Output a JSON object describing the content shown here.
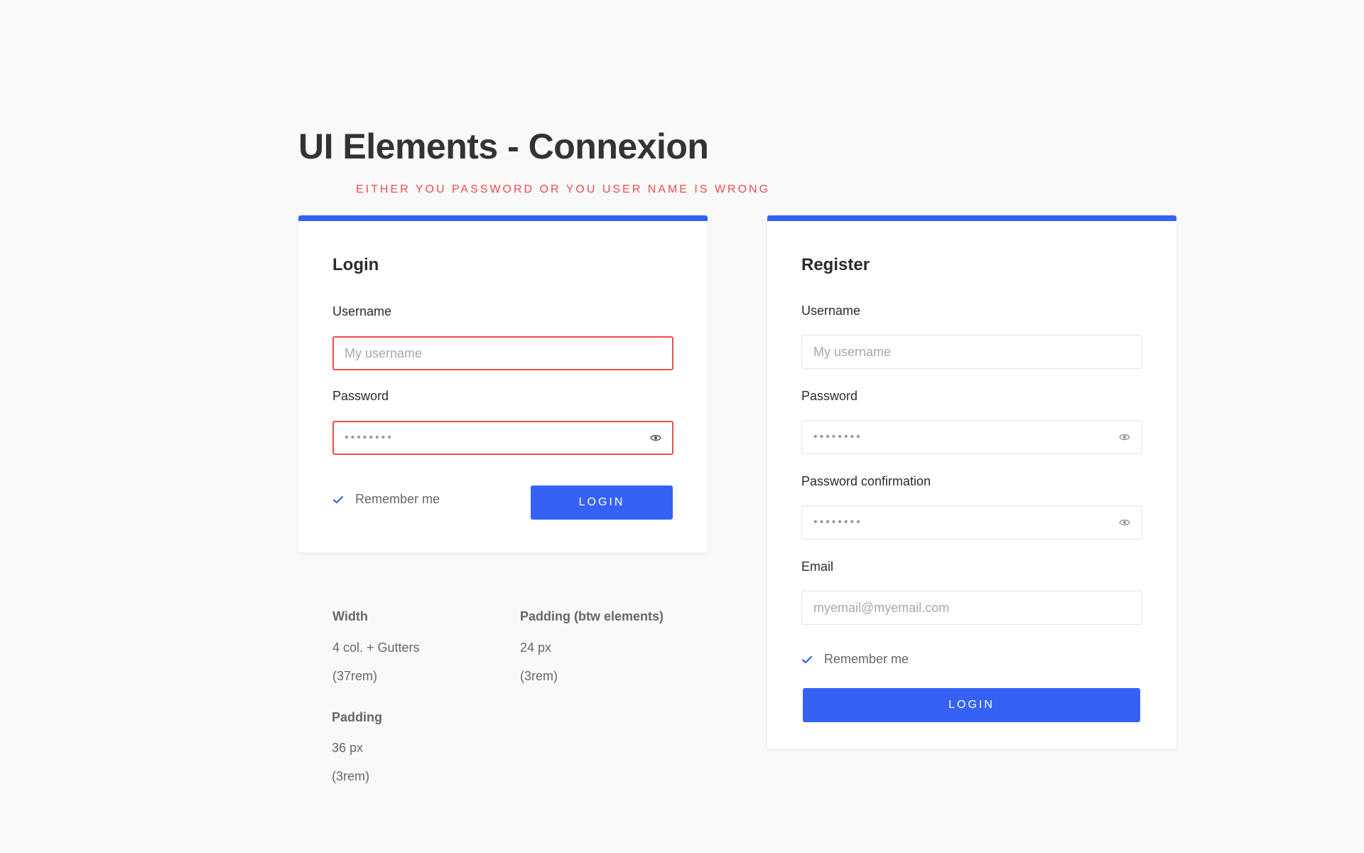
{
  "page": {
    "title": "UI Elements - Connexion",
    "error_message": "EITHER YOU PASSWORD OR YOU USER NAME IS WRONG"
  },
  "colors": {
    "accent": "#3562f5",
    "error": "#ef4c4c",
    "background": "#f9f9f9"
  },
  "login": {
    "title": "Login",
    "username_label": "Username",
    "username_placeholder": "My username",
    "username_value": "",
    "password_label": "Password",
    "password_mask": "••••••••",
    "password_toggle_icon": "eye-icon",
    "remember_label": "Remember me",
    "remember_checked": true,
    "button_label": "LOGIN"
  },
  "register": {
    "title": "Register",
    "username_label": "Username",
    "username_placeholder": "My username",
    "password_label": "Password",
    "password_mask": "••••••••",
    "password_confirmation_label": "Password confirmation",
    "password_confirmation_mask": "••••••••",
    "email_label": "Email",
    "email_placeholder": "myemail@myemail.com",
    "remember_label": "Remember me",
    "remember_checked": true,
    "button_label": "LOGIN"
  },
  "specs": {
    "width": {
      "heading": "Width",
      "line1": "4 col. + Gutters",
      "line2": "(37rem)"
    },
    "padding_between": {
      "heading": "Padding (btw elements)",
      "line1": "24 px",
      "line2": "(3rem)"
    },
    "padding": {
      "heading": "Padding",
      "line1": "36 px",
      "line2": "(3rem)"
    }
  }
}
